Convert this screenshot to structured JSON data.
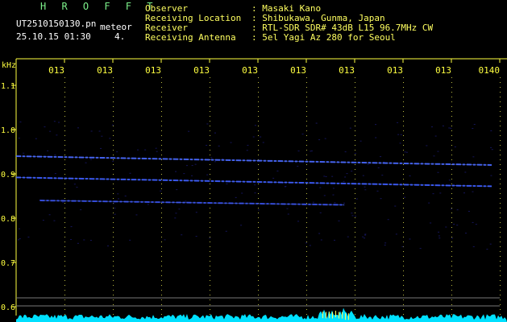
{
  "header": {
    "title": "H R O F F T",
    "filename": "UT2510150130.pn",
    "mode": "meteor",
    "datetime": "25.10.15 01:30",
    "index": "4.",
    "labels": [
      "Observer",
      "Receiving Location",
      "Receiver",
      "Receiving Antenna"
    ],
    "values": [
      ": Masaki Kano",
      ": Shibukawa, Gunma, Japan",
      ": RTL-SDR SDR# 43dB L15 96.7MHz CW",
      ": 5el Yagi Az 280 for Seoul"
    ]
  },
  "axes": {
    "y_unit": "kHz",
    "y_ticks": [
      {
        "label": "1.1",
        "value": 1.1
      },
      {
        "label": "1.0",
        "value": 1.0
      },
      {
        "label": "0.9",
        "value": 0.9
      },
      {
        "label": "0.8",
        "value": 0.8
      },
      {
        "label": "0.7",
        "value": 0.7
      },
      {
        "label": "0.6",
        "value": 0.6
      }
    ],
    "x_ticks": [
      "013",
      "013",
      "013",
      "013",
      "013",
      "013",
      "013",
      "013",
      "013",
      "0140"
    ]
  },
  "chart_data": {
    "type": "heatmap",
    "y_range": [
      0.58,
      1.16
    ],
    "x_range": [
      0,
      10
    ],
    "traces": [
      {
        "y_start": 0.94,
        "y_end": 0.92,
        "x_start": 0.0,
        "x_end": 10.0,
        "color": "#4060ff"
      },
      {
        "y_start": 0.892,
        "y_end": 0.872,
        "x_start": 0.0,
        "x_end": 10.0,
        "color": "#3050ff"
      },
      {
        "y_start": 0.84,
        "y_end": 0.83,
        "x_start": 0.5,
        "x_end": 6.9,
        "color": "#2a40e0"
      }
    ],
    "colors": {
      "signal": "#4060ff",
      "spectrum": "#00e0ff",
      "axis_text": "#ffff40",
      "header_white": "#ffffff",
      "title_green": "#7cf08a"
    }
  }
}
